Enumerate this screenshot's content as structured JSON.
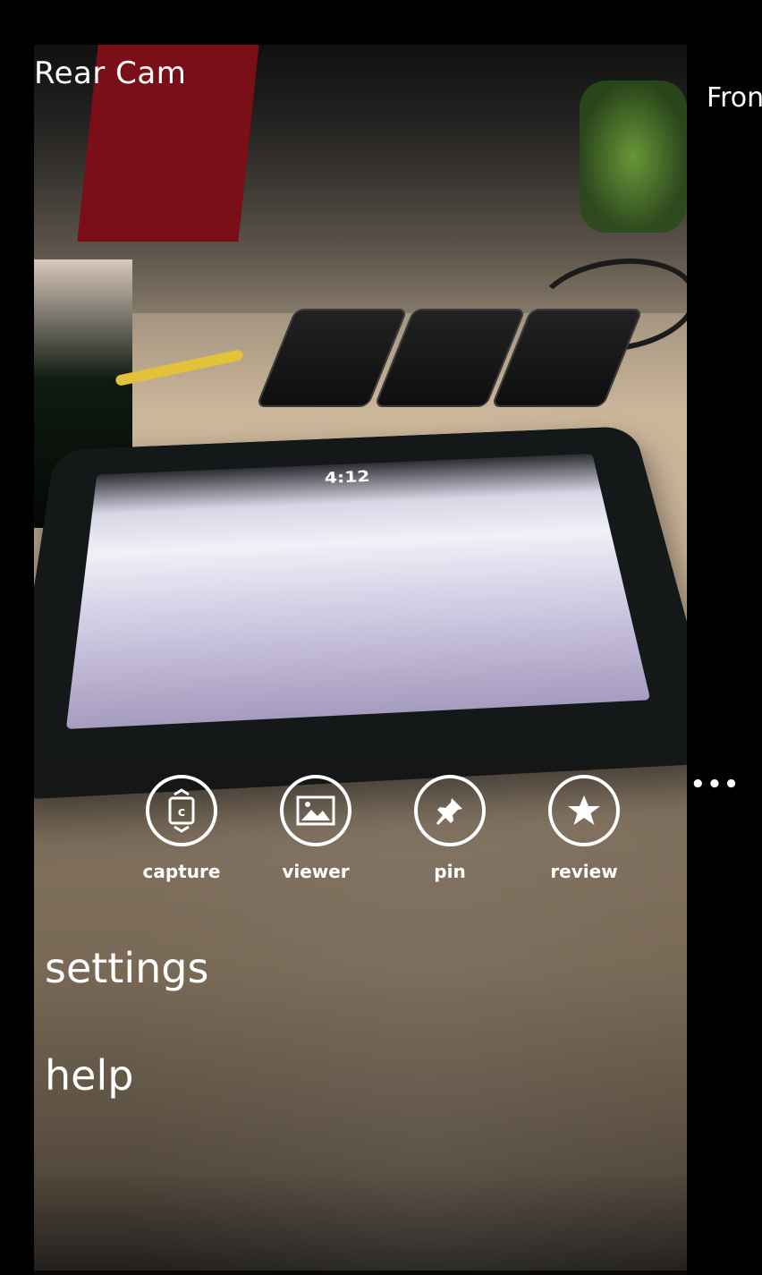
{
  "pivot": {
    "current_title": "Rear Cam",
    "next_title": "Front"
  },
  "preview": {
    "tablet_clock": "4:12"
  },
  "app_bar": {
    "more_glyph": "•••",
    "buttons": [
      {
        "label": "capture",
        "icon": "camera-switch-icon"
      },
      {
        "label": "viewer",
        "icon": "picture-icon"
      },
      {
        "label": "pin",
        "icon": "pin-icon"
      },
      {
        "label": "review",
        "icon": "star-icon"
      }
    ],
    "menu_items": [
      {
        "label": "settings"
      },
      {
        "label": "help"
      }
    ]
  },
  "colors": {
    "background": "#000000",
    "foreground": "#ffffff"
  }
}
